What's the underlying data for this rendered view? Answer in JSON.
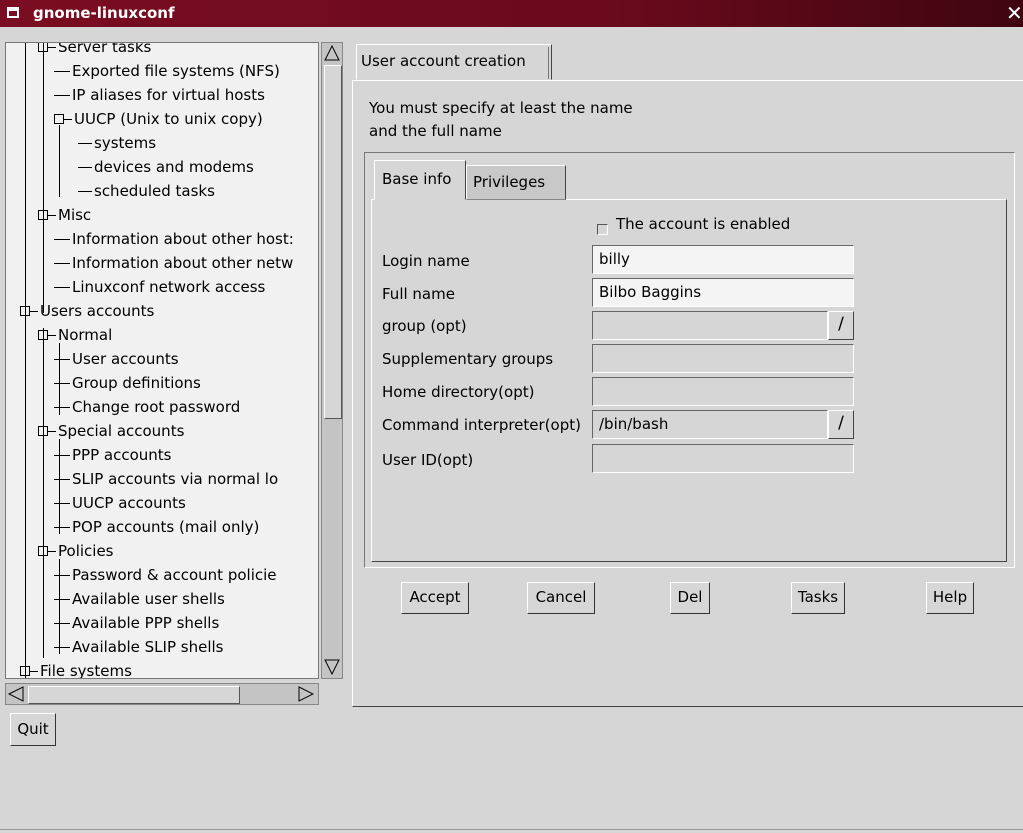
{
  "window": {
    "title": "gnome-linuxconf"
  },
  "tree": {
    "items": [
      {
        "label": "Server tasks",
        "depth": 1,
        "expander": true
      },
      {
        "label": "Exported file systems (NFS)",
        "depth": 2
      },
      {
        "label": "IP aliases for virtual hosts",
        "depth": 2
      },
      {
        "label": "UUCP (Unix to unix copy)",
        "depth": 2,
        "expander": true
      },
      {
        "label": "systems",
        "depth": 3
      },
      {
        "label": "devices and modems",
        "depth": 3
      },
      {
        "label": "scheduled tasks",
        "depth": 3
      },
      {
        "label": "Misc",
        "depth": 1,
        "expander": true
      },
      {
        "label": "Information about other host:",
        "depth": 2
      },
      {
        "label": "Information about other netw",
        "depth": 2
      },
      {
        "label": "Linuxconf network access",
        "depth": 2
      },
      {
        "label": "Users accounts",
        "depth": 0,
        "expander": true
      },
      {
        "label": "Normal",
        "depth": 1,
        "expander": true
      },
      {
        "label": "User accounts",
        "depth": 2
      },
      {
        "label": "Group definitions",
        "depth": 2
      },
      {
        "label": "Change root password",
        "depth": 2
      },
      {
        "label": "Special accounts",
        "depth": 1,
        "expander": true
      },
      {
        "label": "PPP accounts",
        "depth": 2
      },
      {
        "label": "SLIP accounts via normal lo",
        "depth": 2
      },
      {
        "label": "UUCP accounts",
        "depth": 2
      },
      {
        "label": "POP accounts (mail only)",
        "depth": 2
      },
      {
        "label": "Policies",
        "depth": 1,
        "expander": true
      },
      {
        "label": "Password & account policie",
        "depth": 2
      },
      {
        "label": "Available user shells",
        "depth": 2
      },
      {
        "label": "Available PPP shells",
        "depth": 2
      },
      {
        "label": "Available SLIP shells",
        "depth": 2
      },
      {
        "label": "File systems",
        "depth": 0,
        "expander": true
      }
    ]
  },
  "main": {
    "tab_label": "User account creation",
    "intro": "You must specify at least the name\nand the full name",
    "subtabs": {
      "base": "Base info",
      "privileges": "Privileges"
    },
    "enabled_label": "The account is enabled",
    "fields": {
      "login": {
        "label": "Login name",
        "value": "billy"
      },
      "fullname": {
        "label": "Full name",
        "value": "Bilbo Baggins"
      },
      "group": {
        "label": "group (opt)",
        "value": ""
      },
      "supp": {
        "label": "Supplementary groups",
        "value": ""
      },
      "home": {
        "label": "Home directory(opt)",
        "value": ""
      },
      "shell": {
        "label": "Command interpreter(opt)",
        "value": "/bin/bash"
      },
      "uid": {
        "label": "User ID(opt)",
        "value": ""
      }
    },
    "buttons": {
      "accept": "Accept",
      "cancel": "Cancel",
      "del": "Del",
      "tasks": "Tasks",
      "help": "Help"
    }
  },
  "footer": {
    "quit": "Quit"
  },
  "icons": {
    "close": "close-icon",
    "window_menu": "window-menu-icon",
    "combo": "dropdown-arrow-icon"
  }
}
